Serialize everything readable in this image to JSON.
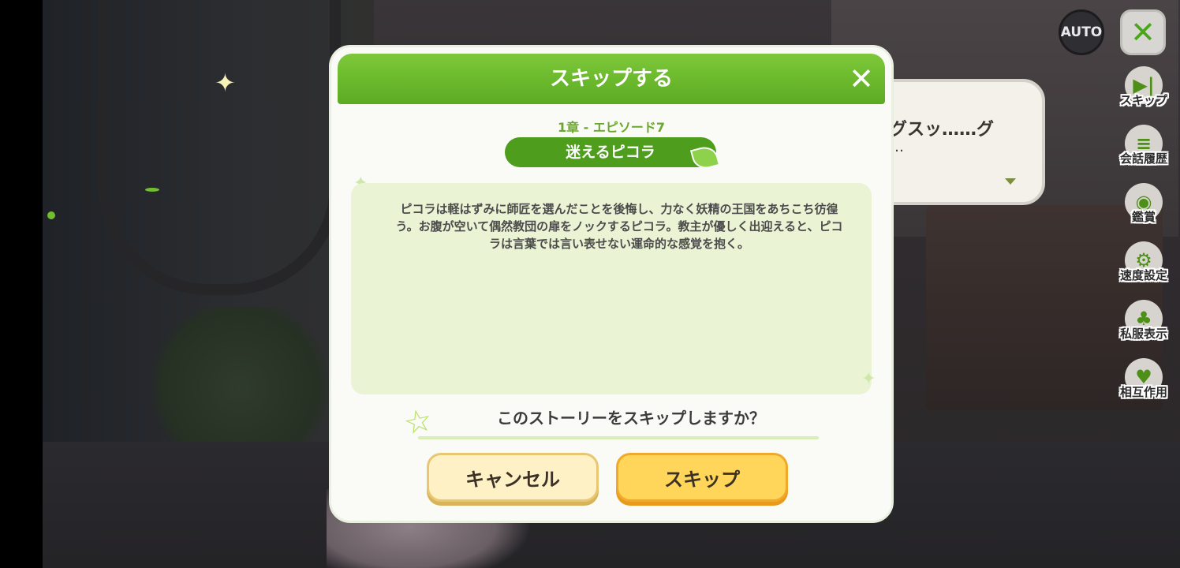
{
  "background_scene": {
    "speech_line1": "グスッ……グ",
    "speech_line2": "…"
  },
  "controls": {
    "auto_label": "AUTO",
    "close_symbol": "✕"
  },
  "side_menu": {
    "items": [
      {
        "label": "スキップ",
        "icon": "skip-forward-icon",
        "glyph": "▶|"
      },
      {
        "label": "会話履歴",
        "icon": "chat-history-icon",
        "glyph": "≡"
      },
      {
        "label": "鑑賞",
        "icon": "camera-icon",
        "glyph": "◉"
      },
      {
        "label": "速度設定",
        "icon": "speed-settings-icon",
        "glyph": "⚙"
      },
      {
        "label": "私服表示",
        "icon": "outfit-icon",
        "glyph": "♣"
      },
      {
        "label": "相互作用",
        "icon": "interaction-icon",
        "glyph": "♥"
      }
    ]
  },
  "modal": {
    "title": "スキップする",
    "close_symbol": "✕",
    "episode": "1章 - エピソード7",
    "chapter_title": "迷えるピコラ",
    "summary": "ピコラは軽はずみに師匠を選んだことを後悔し、力なく妖精の王国をあちこち彷徨う。お腹が空いて偶然教団の扉をノックするピコラ。教主が優しく出迎えると、ピコラは言葉では言い表せない運命的な感覚を抱く。",
    "question": "このストーリーをスキップしますか？",
    "cancel_label": "キャンセル",
    "skip_label": "スキップ"
  },
  "colors": {
    "header_green": "#5bab22",
    "accent_green": "#4f9d1c",
    "summary_bg": "#eaf4d4",
    "skip_button": "#ffd65a",
    "cancel_button": "#fff1c6"
  }
}
